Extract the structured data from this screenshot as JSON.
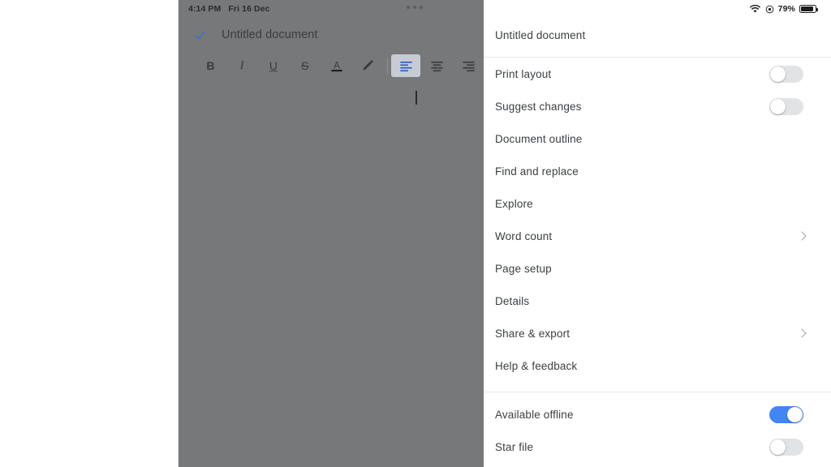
{
  "document_pane": {
    "status_bar": {
      "time": "4:14 PM",
      "date": "Fri 16 Dec",
      "overflow_icon": "more-horizontal-icon"
    },
    "check_icon": "checkmark-icon",
    "title": "Untitled document",
    "toolbar": [
      {
        "name": "bold",
        "glyph": "B",
        "active": false
      },
      {
        "name": "italic",
        "glyph": "I",
        "active": false
      },
      {
        "name": "underline",
        "glyph": "U",
        "active": false
      },
      {
        "name": "strikethrough",
        "glyph": "S",
        "active": false
      },
      {
        "name": "text-color",
        "glyph": "A",
        "active": false
      },
      {
        "name": "highlight-color",
        "glyph": "pencil",
        "active": false
      },
      {
        "name": "align-left",
        "glyph": "align-left",
        "active": true
      },
      {
        "name": "align-center",
        "glyph": "align-center",
        "active": false
      },
      {
        "name": "align-right",
        "glyph": "align-right",
        "active": false
      }
    ]
  },
  "menu": {
    "status_bar": {
      "wifi_icon": "wifi-icon",
      "location_icon": "location-icon",
      "battery_percent": "79%",
      "battery_icon": "battery-icon",
      "battery_level": 79
    },
    "title": "Untitled document",
    "items": [
      {
        "label": "Print layout",
        "control": "toggle",
        "value": false
      },
      {
        "label": "Suggest changes",
        "control": "toggle",
        "value": false
      },
      {
        "label": "Document outline",
        "control": "none"
      },
      {
        "label": "Find and replace",
        "control": "none"
      },
      {
        "label": "Explore",
        "control": "none"
      },
      {
        "label": "Word count",
        "control": "chevron"
      },
      {
        "label": "Page setup",
        "control": "none"
      },
      {
        "label": "Details",
        "control": "none"
      },
      {
        "label": "Share & export",
        "control": "chevron"
      },
      {
        "label": "Help & feedback",
        "control": "none"
      }
    ],
    "items_secondary": [
      {
        "label": "Available offline",
        "control": "toggle",
        "value": true
      },
      {
        "label": "Star file",
        "control": "toggle",
        "value": false
      }
    ]
  },
  "colors": {
    "accent_blue": "#4285f4",
    "dim_overlay": "#777879",
    "text_primary": "#3c4043",
    "toggle_off": "#e2e3e5"
  }
}
